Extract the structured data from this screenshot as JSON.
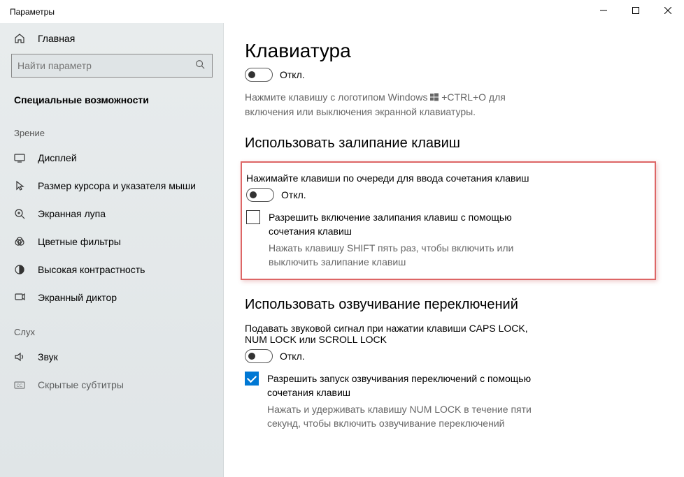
{
  "window": {
    "title": "Параметры"
  },
  "sidebar": {
    "home_label": "Главная",
    "search_placeholder": "Найти параметр",
    "current_category": "Специальные возможности",
    "sections": [
      {
        "title": "Зрение",
        "items": [
          {
            "icon": "display",
            "label": "Дисплей"
          },
          {
            "icon": "cursor",
            "label": "Размер курсора и указателя мыши"
          },
          {
            "icon": "magnifier",
            "label": "Экранная лупа"
          },
          {
            "icon": "color-filters",
            "label": "Цветные фильтры"
          },
          {
            "icon": "contrast",
            "label": "Высокая контрастность"
          },
          {
            "icon": "narrator",
            "label": "Экранный диктор"
          }
        ]
      },
      {
        "title": "Слух",
        "items": [
          {
            "icon": "audio",
            "label": "Звук"
          },
          {
            "icon": "cc",
            "label": "Скрытые субтитры"
          }
        ]
      }
    ]
  },
  "main": {
    "title": "Клавиатура",
    "toggle1_state": "Откл.",
    "hint1": "Нажмите клавишу с логотипом Windows",
    "hint1b": "+CTRL+O для включения или выключения экранной клавиатуры.",
    "section2_title": "Использовать залипание клавиш",
    "sticky_label": "Нажимайте клавиши по очереди для ввода сочетания клавиш",
    "sticky_state": "Откл.",
    "sticky_check_label": "Разрешить включение залипания клавиш с помощью сочетания клавиш",
    "sticky_check_desc": "Нажать клавишу SHIFT пять раз, чтобы включить или выключить залипание клавиш",
    "section3_title": "Использовать озвучивание переключений",
    "toggle3_label": "Подавать звуковой сигнал при нажатии клавиши CAPS LOCK, NUM LOCK или SCROLL LOCK",
    "toggle3_state": "Откл.",
    "toggle3_check_label": "Разрешить запуск озвучивания переключений с помощью сочетания клавиш",
    "toggle3_check_desc": "Нажать и удерживать клавишу NUM LOCK в течение пяти секунд, чтобы включить озвучивание переключений"
  }
}
